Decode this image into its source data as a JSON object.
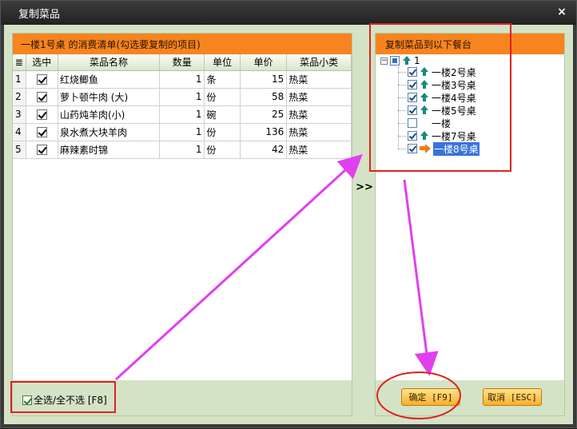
{
  "window": {
    "title": "复制菜品",
    "close_label": "×"
  },
  "left_panel": {
    "header": "一楼1号桌 的消费清单(勾选要复制的项目)",
    "columns": [
      "≣",
      "选中",
      "菜品名称",
      "数量",
      "单位",
      "单价",
      "菜品小类"
    ],
    "rows": [
      {
        "idx": "1",
        "checked": true,
        "name": "红烧鲫鱼",
        "qty": "1",
        "unit": "条",
        "price": "15",
        "category": "热菜"
      },
      {
        "idx": "2",
        "checked": true,
        "name": "萝卜顿牛肉 (大)",
        "qty": "1",
        "unit": "份",
        "price": "58",
        "category": "热菜"
      },
      {
        "idx": "3",
        "checked": true,
        "name": "山药炖羊肉(小)",
        "qty": "1",
        "unit": "碗",
        "price": "25",
        "category": "热菜"
      },
      {
        "idx": "4",
        "checked": true,
        "name": "泉水煮大块羊肉",
        "qty": "1",
        "unit": "份",
        "price": "136",
        "category": "热菜"
      },
      {
        "idx": "5",
        "checked": true,
        "name": "麻辣素时锦",
        "qty": "1",
        "unit": "份",
        "price": "42",
        "category": "热菜"
      }
    ],
    "select_all_label": "全选/全不选 [F8]"
  },
  "transfer_button": ">>",
  "right_panel": {
    "header": "复制菜品到以下餐台",
    "tree": {
      "root": {
        "label": "1",
        "state": "partial"
      },
      "children": [
        {
          "label": "一楼2号桌",
          "checked": true,
          "icon": "up-arrow-icon",
          "selected": false
        },
        {
          "label": "一楼3号桌",
          "checked": true,
          "icon": "up-arrow-icon",
          "selected": false
        },
        {
          "label": "一楼4号桌",
          "checked": true,
          "icon": "up-arrow-icon",
          "selected": false
        },
        {
          "label": "一楼5号桌",
          "checked": true,
          "icon": "up-arrow-icon",
          "selected": false
        },
        {
          "label": "一楼",
          "checked": false,
          "icon": "none",
          "selected": false
        },
        {
          "label": "一楼7号桌",
          "checked": true,
          "icon": "up-arrow-icon",
          "selected": false
        },
        {
          "label": "一楼8号桌",
          "checked": true,
          "icon": "right-arrow-icon",
          "selected": true
        }
      ]
    },
    "confirm_label": "确定 [F9]",
    "cancel_label": "取消 [ESC]"
  },
  "colors": {
    "header_orange": "#f7841f",
    "annotation_red": "#e02020",
    "annotation_magenta": "#e040f0",
    "button_gold": "#f6b02d"
  }
}
